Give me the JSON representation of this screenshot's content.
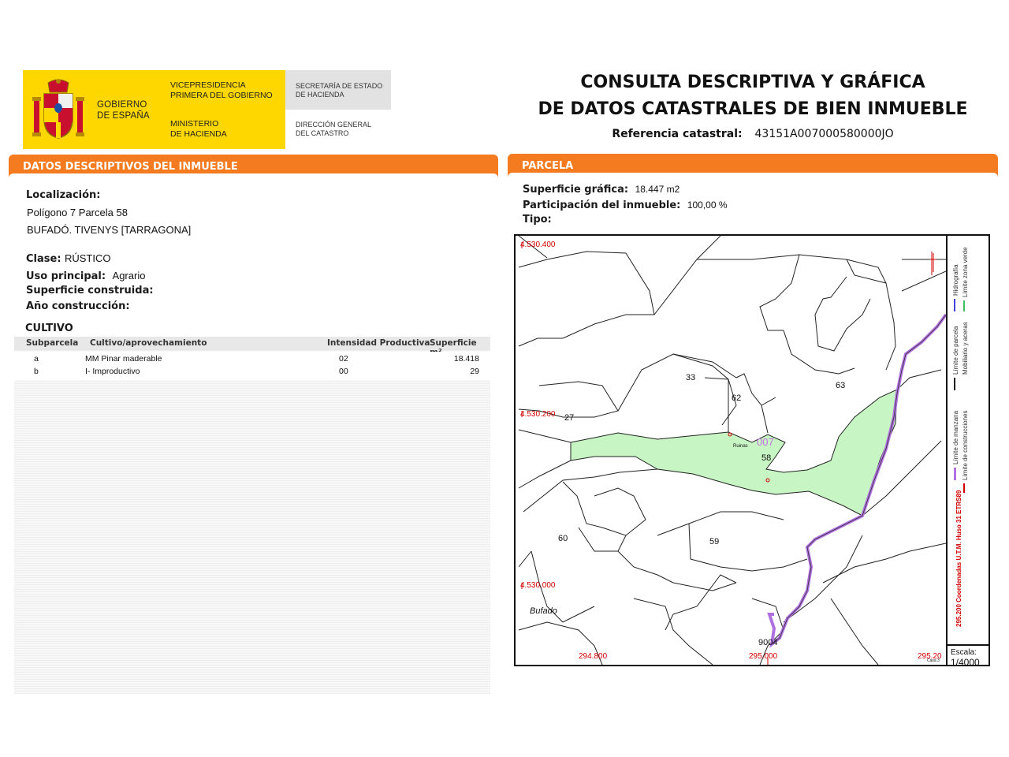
{
  "header": {
    "gobierno": [
      "GOBIERNO",
      "DE ESPAÑA"
    ],
    "vicepresidencia": [
      "VICEPRESIDENCIA",
      "PRIMERA DEL GOBIERNO"
    ],
    "ministerio": [
      "MINISTERIO",
      "DE HACIENDA"
    ],
    "secretaria": [
      "SECRETARÍA DE ESTADO",
      "DE HACIENDA"
    ],
    "direccion": [
      "DIRECCIÓN GENERAL",
      "DEL CATASTRO"
    ],
    "title_line1": "CONSULTA DESCRIPTIVA Y GRÁFICA",
    "title_line2": "DE DATOS CATASTRALES DE BIEN INMUEBLE",
    "ref_label": "Referencia catastral:",
    "ref_value": "43151A007000580000JO"
  },
  "left": {
    "section_title": "DATOS DESCRIPTIVOS DEL INMUEBLE",
    "localizacion_label": "Localización:",
    "localizacion_line1": "Polígono 7 Parcela 58",
    "localizacion_line2": "BUFADÓ. TIVENYS [TARRAGONA]",
    "clase_label": "Clase:",
    "clase_value": "RÚSTICO",
    "uso_label": "Uso principal:",
    "uso_value": "Agrario",
    "superficie_label": "Superficie construida:",
    "anio_label": "Año construcción:",
    "cultivo": {
      "title": "CULTIVO",
      "headers": [
        "Subparcela",
        "Cultivo/aprovechamiento",
        "Intensidad Productiva",
        "Superficie m²"
      ],
      "rows": [
        [
          "a",
          "MM Pinar maderable",
          "02",
          "18.418"
        ],
        [
          "b",
          "I- Improductivo",
          "00",
          "29"
        ]
      ]
    }
  },
  "right": {
    "section_title": "PARCELA",
    "superficie_label": "Superficie gráfica:",
    "superficie_value": "18.447 m2",
    "participacion_label": "Participación del inmueble:",
    "participacion_value": "100,00 %",
    "tipo_label": "Tipo:",
    "map": {
      "coord_top": "4.530.400",
      "coord_mid": "4.530.200",
      "coord_low": "4.530.000",
      "coord_x1": "294.800",
      "coord_x2": "295.000",
      "coord_x3": "295.20",
      "labels": [
        "27",
        "33",
        "62",
        "63",
        "007",
        "58",
        "60",
        "59",
        "9004"
      ],
      "place_name": "Bufado",
      "ruinas": "Ruinas",
      "casa": "Casa 3",
      "legend_1": "Límite de parcela",
      "legend_2": "Hidrografía",
      "legend_3": "Límite zona verde",
      "legend_4": "Mobiliario y aceras",
      "legend_5": "Límite de manzana",
      "legend_6": "Límite de construcciones",
      "utm": "295.200 Coordenadas U.T.M. Huso 31 ETRS89",
      "scale_label": "Escala:",
      "scale_value": "1/4000"
    }
  },
  "colors": {
    "orange": "#f47b20",
    "yellow": "#ffd700",
    "parcel_fill": "#c8f5c4",
    "river": "#b070e0",
    "coord_red": "#d00000"
  }
}
